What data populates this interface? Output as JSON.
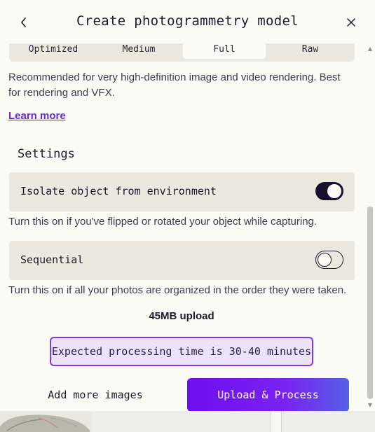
{
  "header": {
    "title": "Create photogrammetry model"
  },
  "quality": {
    "options": [
      "Optimized",
      "Medium",
      "Full",
      "Raw"
    ],
    "selected": "Full",
    "description": "Recommended for very high-definition image and video rendering. Best for rendering and VFX.",
    "learn_more": "Learn more"
  },
  "settings": {
    "heading": "Settings",
    "isolate": {
      "label": "Isolate object from environment",
      "enabled": true,
      "help": "Turn this on if you've flipped or rotated your object while capturing."
    },
    "sequential": {
      "label": "Sequential",
      "enabled": false,
      "help": "Turn this on if all your photos are organized in the order they were taken."
    }
  },
  "upload": {
    "size": "45MB upload",
    "expected": "Expected processing time is 30-40 minutes",
    "add_more_label": "Add more images",
    "upload_label": "Upload & Process"
  },
  "colors": {
    "accent": "#7c3aed",
    "button_gradient_start": "#6d0ff0",
    "button_gradient_end": "#5660e8",
    "card_bg": "#ebe9df",
    "page_bg": "#fbfbf5"
  }
}
